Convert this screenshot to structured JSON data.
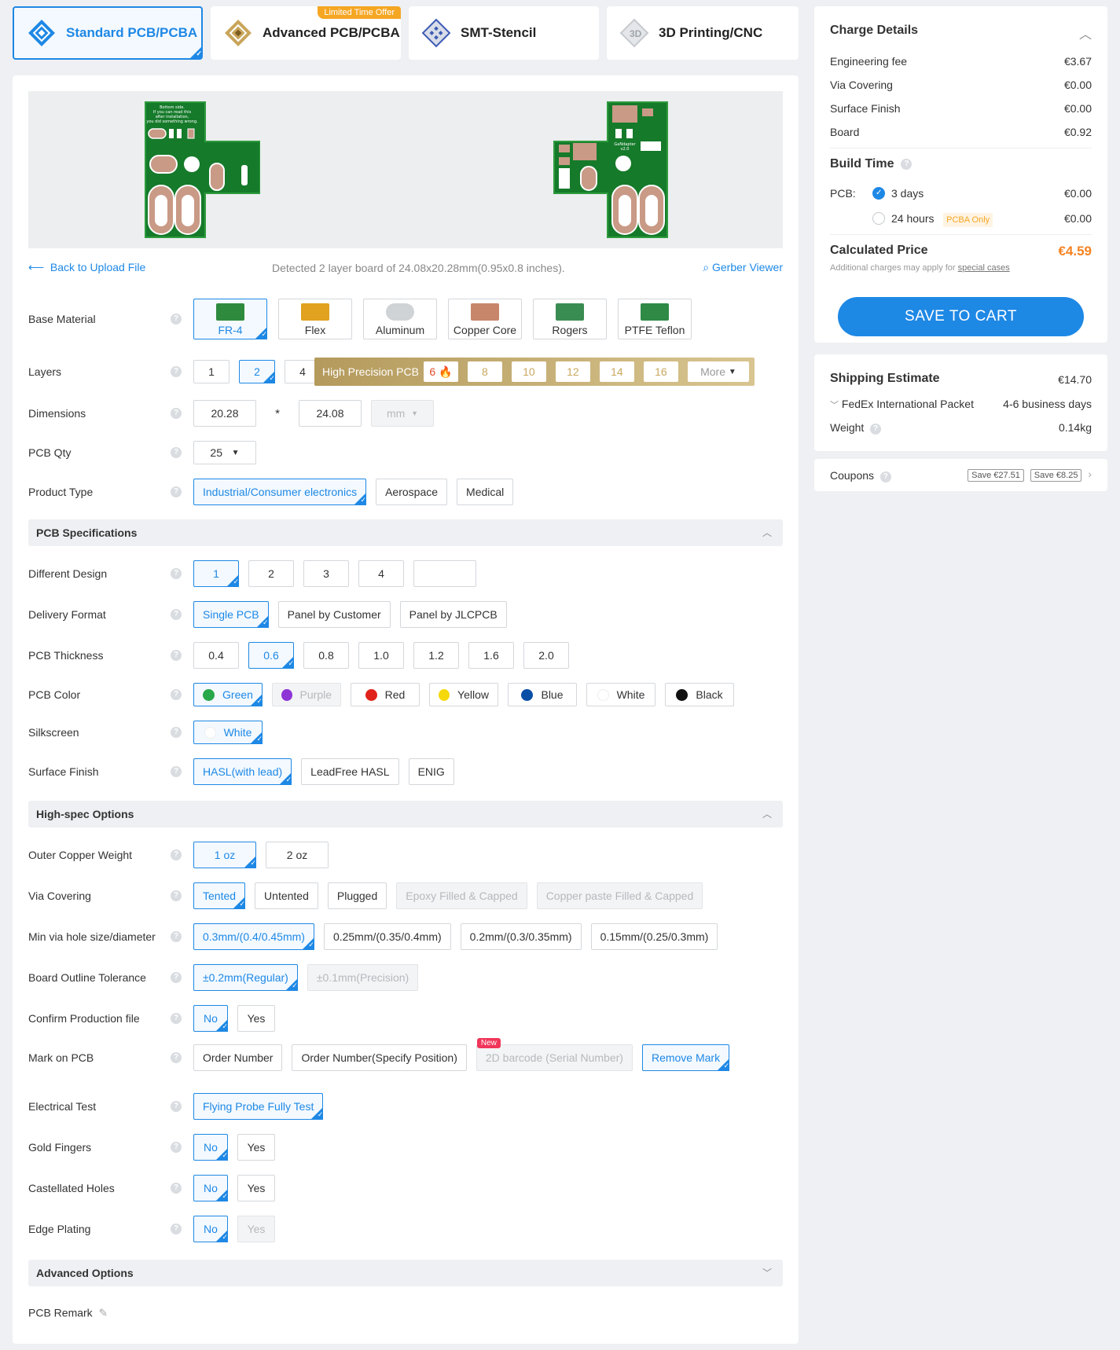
{
  "tabs": [
    {
      "label": "Standard PCB/PCBA",
      "icon": "standard-pcb-icon"
    },
    {
      "label": "Advanced PCB/PCBA",
      "icon": "advanced-pcb-icon",
      "badge": "Limited Time Offer"
    },
    {
      "label": "SMT-Stencil",
      "icon": "stencil-icon"
    },
    {
      "label": "3D Printing/CNC",
      "icon": "3d-printing-icon"
    }
  ],
  "preview": {
    "bottom_text": "Bottom side.\nIf you can read this\nafter installation,\nyou did something wrong.",
    "top_text": "GaNdapter\nv2.0",
    "back_link": "Back to Upload File",
    "detected": "Detected 2 layer board of 24.08x20.28mm(0.95x0.8 inches).",
    "gerber_viewer": "Gerber Viewer"
  },
  "base_material": {
    "label": "Base Material",
    "options": [
      "FR-4",
      "Flex",
      "Aluminum",
      "Copper Core",
      "Rogers",
      "PTFE Teflon"
    ],
    "selected": "FR-4"
  },
  "layers": {
    "label": "Layers",
    "options": [
      "1",
      "2",
      "4"
    ],
    "selected": "2",
    "high_precision": "High Precision PCB",
    "hp_options": [
      "6",
      "8",
      "10",
      "12",
      "14",
      "16"
    ],
    "more": "More"
  },
  "dimensions": {
    "label": "Dimensions",
    "width": "20.28",
    "sep": "*",
    "height": "24.08",
    "unit": "mm"
  },
  "pcb_qty": {
    "label": "PCB Qty",
    "value": "25"
  },
  "product_type": {
    "label": "Product Type",
    "options": [
      "Industrial/Consumer electronics",
      "Aerospace",
      "Medical"
    ],
    "selected": "Industrial/Consumer electronics"
  },
  "pcb_specs": {
    "title": "PCB Specifications",
    "different_design": {
      "label": "Different Design",
      "options": [
        "1",
        "2",
        "3",
        "4",
        ""
      ],
      "selected": "1"
    },
    "delivery_format": {
      "label": "Delivery Format",
      "options": [
        "Single PCB",
        "Panel by Customer",
        "Panel by JLCPCB"
      ],
      "selected": "Single PCB"
    },
    "thickness": {
      "label": "PCB Thickness",
      "options": [
        "0.4",
        "0.6",
        "0.8",
        "1.0",
        "1.2",
        "1.6",
        "2.0"
      ],
      "selected": "0.6"
    },
    "color": {
      "label": "PCB Color",
      "options": [
        {
          "name": "Green",
          "color": "#27a84a"
        },
        {
          "name": "Purple",
          "color": "#8e35d6"
        },
        {
          "name": "Red",
          "color": "#e0231a"
        },
        {
          "name": "Yellow",
          "color": "#f5d90c"
        },
        {
          "name": "Blue",
          "color": "#0a4fa6"
        },
        {
          "name": "White",
          "color": "#ffffff"
        },
        {
          "name": "Black",
          "color": "#111111"
        }
      ],
      "selected": "Green"
    },
    "silkscreen": {
      "label": "Silkscreen",
      "value": "White"
    },
    "surface_finish": {
      "label": "Surface Finish",
      "options": [
        "HASL(with lead)",
        "LeadFree HASL",
        "ENIG"
      ],
      "selected": "HASL(with lead)"
    }
  },
  "high_spec": {
    "title": "High-spec Options",
    "copper": {
      "label": "Outer Copper Weight",
      "options": [
        "1 oz",
        "2 oz"
      ],
      "selected": "1 oz"
    },
    "via_covering": {
      "label": "Via Covering",
      "options": [
        "Tented",
        "Untented",
        "Plugged",
        "Epoxy Filled & Capped",
        "Copper paste Filled & Capped"
      ],
      "selected": "Tented"
    },
    "min_via": {
      "label": "Min via hole size/diameter",
      "options": [
        "0.3mm/(0.4/0.45mm)",
        "0.25mm/(0.35/0.4mm)",
        "0.2mm/(0.3/0.35mm)",
        "0.15mm/(0.25/0.3mm)"
      ],
      "selected": "0.3mm/(0.4/0.45mm)"
    },
    "outline_tol": {
      "label": "Board Outline Tolerance",
      "options": [
        "±0.2mm(Regular)",
        "±0.1mm(Precision)"
      ],
      "selected": "±0.2mm(Regular)"
    },
    "confirm_file": {
      "label": "Confirm Production file",
      "options": [
        "No",
        "Yes"
      ],
      "selected": "No"
    },
    "mark": {
      "label": "Mark on PCB",
      "options": [
        "Order Number",
        "Order Number(Specify Position)",
        "2D barcode (Serial Number)",
        "Remove Mark"
      ],
      "selected": "Remove Mark",
      "new_badge": "New"
    },
    "electrical_test": {
      "label": "Electrical Test",
      "value": "Flying Probe Fully Test"
    },
    "gold_fingers": {
      "label": "Gold Fingers",
      "options": [
        "No",
        "Yes"
      ],
      "selected": "No"
    },
    "castellated": {
      "label": "Castellated Holes",
      "options": [
        "No",
        "Yes"
      ],
      "selected": "No"
    },
    "edge_plating": {
      "label": "Edge Plating",
      "options": [
        "No",
        "Yes"
      ],
      "selected": "No"
    }
  },
  "advanced": {
    "title": "Advanced Options",
    "remark_label": "PCB Remark"
  },
  "charge": {
    "title": "Charge Details",
    "items": [
      {
        "label": "Engineering fee",
        "value": "€3.67"
      },
      {
        "label": "Via Covering",
        "value": "€0.00"
      },
      {
        "label": "Surface Finish",
        "value": "€0.00"
      },
      {
        "label": "Board",
        "value": "€0.92"
      }
    ],
    "build_time": "Build Time",
    "pcb_label": "PCB:",
    "opt_3days": "3 days",
    "opt_3days_price": "€0.00",
    "opt_24h": "24 hours",
    "opt_24h_price": "€0.00",
    "pcba_only": "PCBA Only",
    "calc_label": "Calculated Price",
    "calc_value": "€4.59",
    "note": "Additional charges may apply for ",
    "note_link": "special cases",
    "save_button": "SAVE TO CART"
  },
  "shipping": {
    "title": "Shipping Estimate",
    "price": "€14.70",
    "carrier": "FedEx International Packet",
    "days": "4-6 business days",
    "weight_label": "Weight",
    "weight": "0.14kg"
  },
  "coupons": {
    "label": "Coupons",
    "tags": [
      "Save €27.51",
      "Save €8.25"
    ]
  }
}
